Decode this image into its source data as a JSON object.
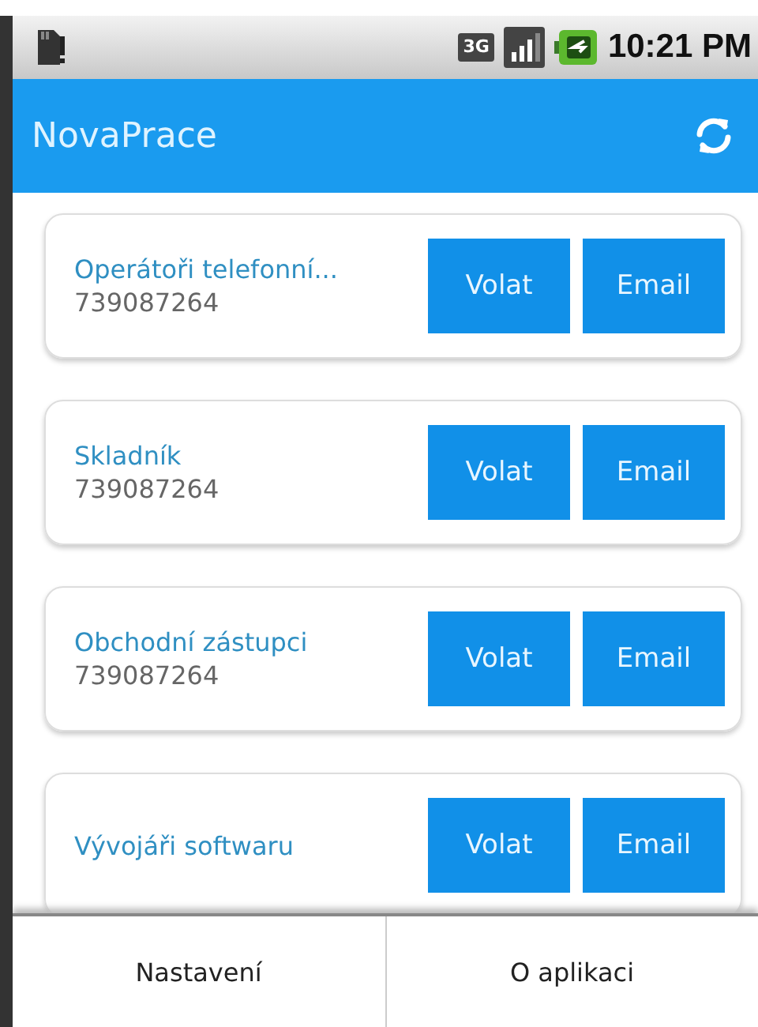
{
  "status_bar": {
    "network": "3G",
    "time": "10:21 PM"
  },
  "action_bar": {
    "title": "NovaPrace"
  },
  "items": [
    {
      "title": "Operátoři telefonní...",
      "phone": "739087264",
      "call": "Volat",
      "email": "Email"
    },
    {
      "title": "Skladník",
      "phone": "739087264",
      "call": "Volat",
      "email": "Email"
    },
    {
      "title": "Obchodní zástupci",
      "phone": "739087264",
      "call": "Volat",
      "email": "Email"
    },
    {
      "title": "Vývojáři softwaru",
      "call": "Volat",
      "email": "Email"
    }
  ],
  "menu": [
    "Nastavení",
    "O aplikaci"
  ]
}
